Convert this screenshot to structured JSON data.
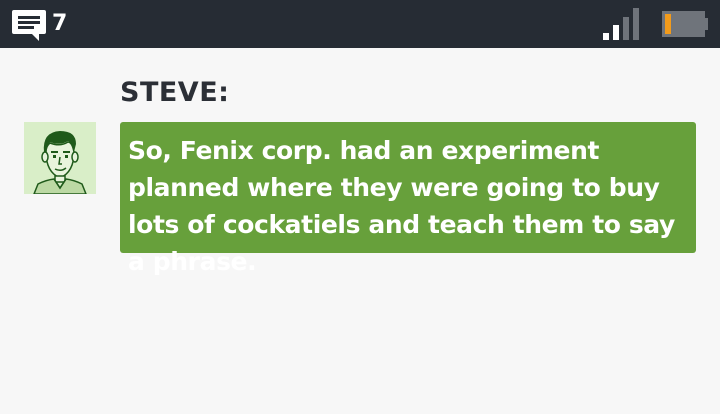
{
  "status_bar": {
    "message_count": "7",
    "icons": {
      "messages": "speech-bubble-icon",
      "signal": "signal-strength-icon",
      "battery": "battery-low-icon"
    },
    "signal_bars_active": 2,
    "signal_bars_total": 4,
    "battery_level": 0.15,
    "colors": {
      "background": "#262c34",
      "battery_fill": "#f29b1b"
    }
  },
  "conversation": {
    "speaker": "STEVE:",
    "avatar_icon": "steve-portrait-avatar",
    "message": "So, Fenix corp. had an experiment planned where they were going to buy lots of cockatiels and teach them to say a phrase.",
    "colors": {
      "bubble": "#67a03b",
      "avatar_background": "#d9eec8"
    }
  }
}
